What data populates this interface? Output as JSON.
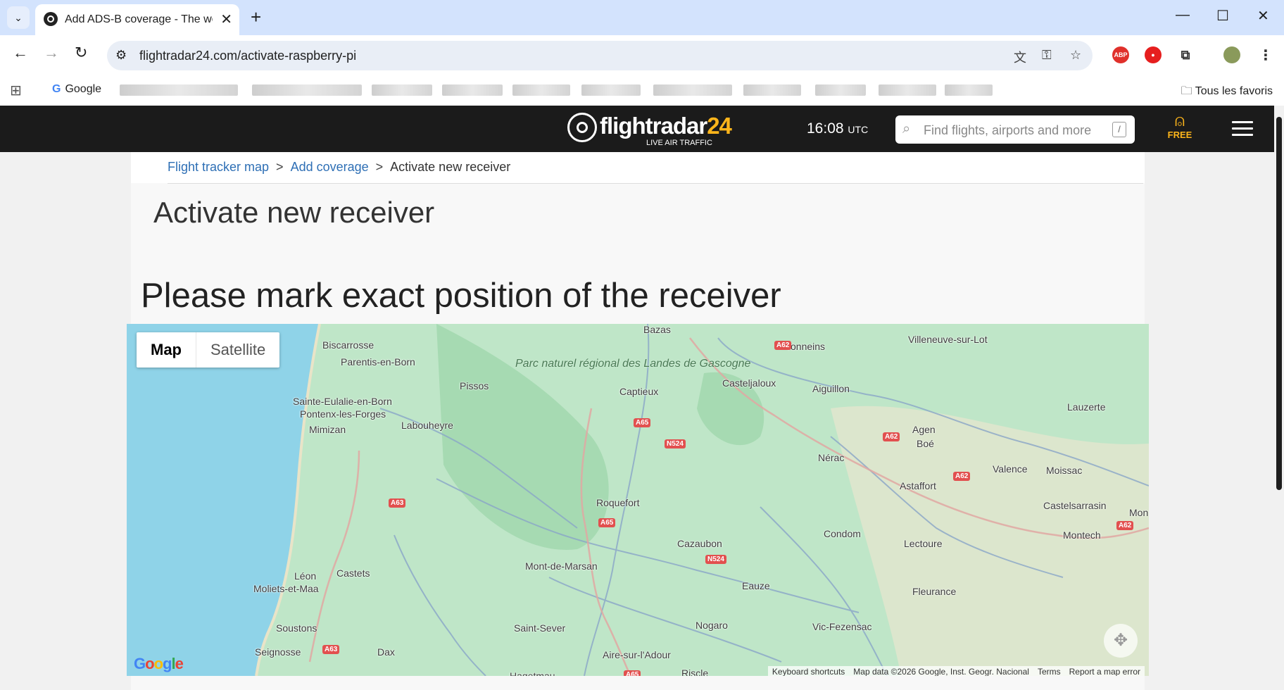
{
  "browser": {
    "tab_title": "Add ADS-B coverage - The world's most popular flight tracker",
    "url": "flightradar24.com/activate-raspberry-pi",
    "bookmark_google": "Google",
    "bookmark_all": "Tous les favoris"
  },
  "header": {
    "logo_main": "flightradar",
    "logo_num": "24",
    "logo_tagline": "LIVE AIR TRAFFIC",
    "time": "16:08",
    "time_zone": "UTC",
    "search_placeholder": "Find flights, airports and more",
    "search_shortcut": "/",
    "user_label": "FREE"
  },
  "breadcrumb": [
    "Flight tracker map",
    "Add coverage",
    "Activate new receiver"
  ],
  "page_title": "Activate new receiver",
  "section_heading": "Please mark exact position of the receiver",
  "map": {
    "type_buttons": [
      "Map",
      "Satellite"
    ],
    "active_type": "Map",
    "park_label": "Parc naturel régional des Landes de Gascogne",
    "places": [
      "Bazas",
      "Tonneins",
      "Villeneuve-sur-Lot",
      "Biscarrosse",
      "Parentis-en-Born",
      "Pissos",
      "Captieux",
      "Casteljaloux",
      "Aiguillon",
      "Lauzerte",
      "Sainte-Eulalie-en-Born",
      "Pontenx-les-Forges",
      "Mimizan",
      "Labouheyre",
      "Agen",
      "Boé",
      "Nérac",
      "Valence",
      "Moissac",
      "Astaffort",
      "Castelsarrasin",
      "Roquefort",
      "Condom",
      "Lectoure",
      "Montech",
      "Cazaubon",
      "Mont-de-Marsan",
      "Castets",
      "Léon",
      "Moliets-et-Maa",
      "Eauze",
      "Fleurance",
      "Soustons",
      "Saint-Sever",
      "Nogaro",
      "Vic-Fezensac",
      "Seignosse",
      "Dax",
      "Aire-sur-l'Adour",
      "Hagetmau",
      "Riscle",
      "Mon"
    ],
    "roads": [
      "A62",
      "A65",
      "N524",
      "A62",
      "A62",
      "A63",
      "A65",
      "N524",
      "A62",
      "A63",
      "A65"
    ],
    "attribution": [
      "Keyboard shortcuts",
      "Map data ©2026 Google, Inst. Geogr. Nacional",
      "Terms",
      "Report a map error"
    ],
    "water_color": "#8fd3e8",
    "land_color": "#bfe6c8"
  }
}
